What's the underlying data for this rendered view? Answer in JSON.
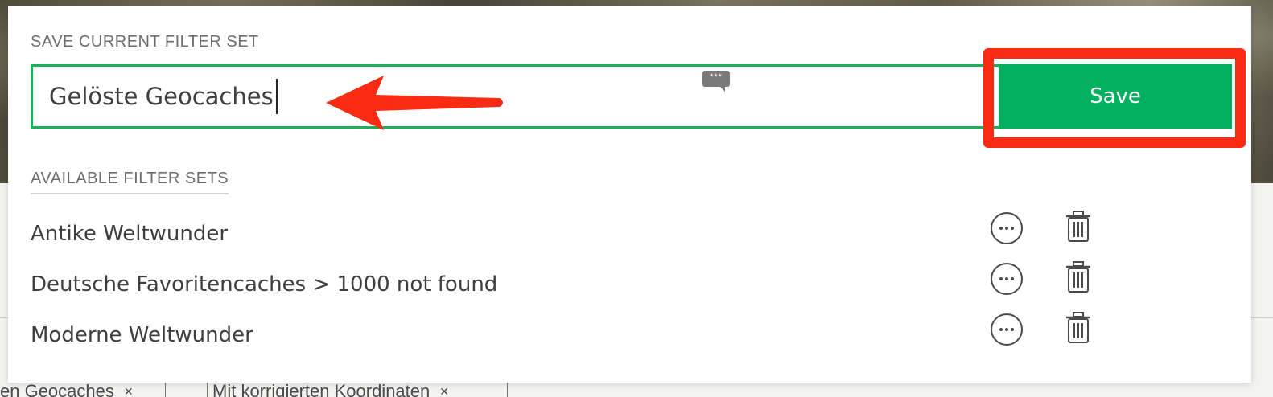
{
  "background": {
    "filter_left_label": "en Geocaches",
    "filter_right_label": "Mit korrigierten Koordinaten"
  },
  "modal": {
    "save_section_title": "SAVE CURRENT FILTER SET",
    "name_input_value": "Gelöste Geocaches",
    "bubble_text": "***",
    "save_label": "Save",
    "available_section_title": "AVAILABLE FILTER SETS",
    "filter_sets": [
      {
        "label": "Antike Weltwunder"
      },
      {
        "label": "Deutsche Favoritencaches > 1000 not found"
      },
      {
        "label": "Moderne Weltwunder"
      }
    ]
  },
  "colors": {
    "accent_green": "#02b05f",
    "annotation_red": "#fb2a12"
  },
  "icons": {
    "more": "more-options-icon",
    "delete": "trash-icon",
    "annotation_arrow": "arrow-left-icon"
  }
}
